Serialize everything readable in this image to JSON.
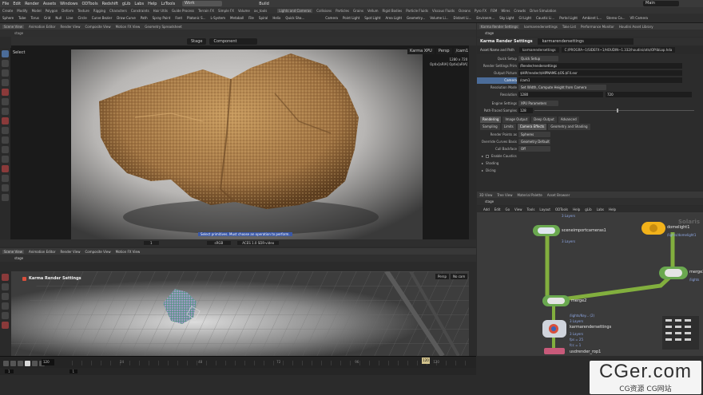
{
  "menubar": {
    "items": [
      "File",
      "Edit",
      "Render",
      "Assets",
      "Windows",
      "ODTools",
      "Redshift",
      "gLib",
      "Labs",
      "Help",
      "LzTools"
    ],
    "build_label": "Build",
    "desk_label": "Work",
    "main_label": "Main"
  },
  "shelf": {
    "tabs": [
      "Create",
      "Modify",
      "Model",
      "Polygon",
      "Deform",
      "Texture",
      "Rigging",
      "Characters",
      "Constraints",
      "Hair Utils",
      "Guide Process",
      "Terrain FX",
      "Simple FX",
      "Volume",
      "ax_tools"
    ],
    "tools": [
      "Sphere",
      "Tube",
      "Torus",
      "Grid",
      "Null",
      "Line",
      "Circle",
      "Curve Bezier",
      "Draw Curve",
      "Path",
      "Spray Paint",
      "Font",
      "Platonic S...",
      "L-System",
      "Metaball",
      "File",
      "Spiral",
      "Helix",
      "Quick Sha..."
    ],
    "right_tools": [
      "Lights and Cameras",
      "Collisions",
      "Particles",
      "Grains",
      "Vellum",
      "Rigid Bodies",
      "Particle Fluids",
      "Viscous Fluids",
      "Oceans",
      "Pyro FX",
      "FEM",
      "Wires",
      "Crowds",
      "Drive Simulation"
    ],
    "light_tools": [
      "Camera",
      "Point Light",
      "Spot Light",
      "Area Light",
      "Geometry...",
      "Volume Li...",
      "Distant Li...",
      "Environm...",
      "Sky Light",
      "GI Light",
      "Caustic Li...",
      "Portal Light",
      "Ambient L...",
      "Stereo Ca...",
      "VR Camera"
    ]
  },
  "scene_view": {
    "tabs": [
      "Scene View",
      "Animation Editor",
      "Render View",
      "Composite View",
      "Motion FX View",
      "Geometry Spreadsheet"
    ],
    "path": "stage",
    "select_label": "Select",
    "toolbar": {
      "mode": "Stage",
      "component": "Component",
      "renderer": "Karma XPU",
      "persp": "Persp",
      "cam": "/cam1"
    },
    "info_lines": [
      "1280 x 720",
      "Optix[aRIA] Optix[aRIA]"
    ],
    "status_hint": "Select primitives. Must choose an operation to perform.",
    "bottom": {
      "color_space": "sRGB",
      "view_transform": "ACES 1.0 SDR-video",
      "frame": "1"
    }
  },
  "scene_view2": {
    "tabs": [
      "Scene View",
      "Animation Editor",
      "Render View",
      "Composite View",
      "Motion FX View"
    ],
    "path": "stage",
    "title": "Karma Render Settings",
    "persp": "Persp",
    "cam": "No cam"
  },
  "timeline": {
    "frame": "120",
    "current_frame": "120",
    "start": "1",
    "end": "1",
    "ticks": [
      "24",
      "48",
      "72",
      "96",
      "120"
    ]
  },
  "parameters": {
    "tabs": [
      "Karma Render Settings",
      "karmarendersettings",
      "Take List",
      "Performance Monitor",
      "Houdini Asset Library"
    ],
    "path": "stage",
    "node_type": "Karma Render Settings",
    "node_name": "karmarendersettings",
    "asset_label": "Asset Name and Path",
    "asset_fields": [
      "karmarendersettings",
      "C:/PROGRA~1/SIDEFX~1/HOUDIN~1.332/houdini/otls/OPlibLop.hda"
    ],
    "rows": [
      {
        "label": "Quick Setup",
        "value": "Quick Setup"
      },
      {
        "label": "Render Settings Prim",
        "value": "/Render/rendersettings"
      },
      {
        "label": "Output Picture",
        "value": "$HIP/render/$HIPNAME.$OS.$F4.exr"
      },
      {
        "label": "Camera",
        "value": "/cam1"
      },
      {
        "label": "Resolution Mode",
        "value": "Set Width, Compute Height from Camera"
      },
      {
        "label": "Resolution",
        "value": "1280",
        "value2": "720"
      },
      {
        "label": "Engine Settings",
        "value": "XPU Parameters"
      },
      {
        "label": "Path-Traced Samples",
        "value": "128"
      }
    ],
    "section_tabs": [
      "Rendering",
      "Image Output",
      "Deep Output",
      "Advanced"
    ],
    "sub_tabs": [
      "Sampling",
      "Limits",
      "Camera Effects",
      "Geometry and Shading"
    ],
    "camera_rows": [
      {
        "label": "Render Points as",
        "value": "Spheres"
      },
      {
        "label": "Override Curves Basis",
        "value": "Geometry Default"
      },
      {
        "label": "Cull Backface",
        "value": "Off"
      }
    ],
    "folds": [
      "Enable Caustics",
      "Shading",
      "Dicing"
    ]
  },
  "network": {
    "tabs": [
      "3D View",
      "Tree View",
      "Material Palette",
      "Asset Browser"
    ],
    "path": "stage",
    "menu": [
      "Add",
      "Edit",
      "Go",
      "View",
      "Tools",
      "Layout",
      "ODTools",
      "Help",
      "gLib",
      "Labs",
      "Help"
    ],
    "context_label": "Solaris",
    "nodes": [
      {
        "name": "sceneimportcameras1",
        "info": "3 Layers"
      },
      {
        "name": "domelight1",
        "path": "/lights/domelight1"
      },
      {
        "name": "merge3",
        "path": "/lights"
      },
      {
        "name": "merge2",
        "info": "3 Layers"
      },
      {
        "name": "karmarendersettings",
        "path": "/lights/Key... (2)",
        "info": "3 Layers",
        "fps": "fps = 25",
        "fc": "fcc = 1"
      },
      {
        "name": "usdrender_rop1"
      }
    ],
    "top_info": "3 Layers"
  },
  "watermark": {
    "main": "CGer.com",
    "sub": "CG资源 CG网站"
  },
  "colors": {
    "accent": "#4b6c99",
    "wire": "#9ed04a",
    "node_green": "#6aa84f",
    "light_node": "#f2b21a"
  }
}
